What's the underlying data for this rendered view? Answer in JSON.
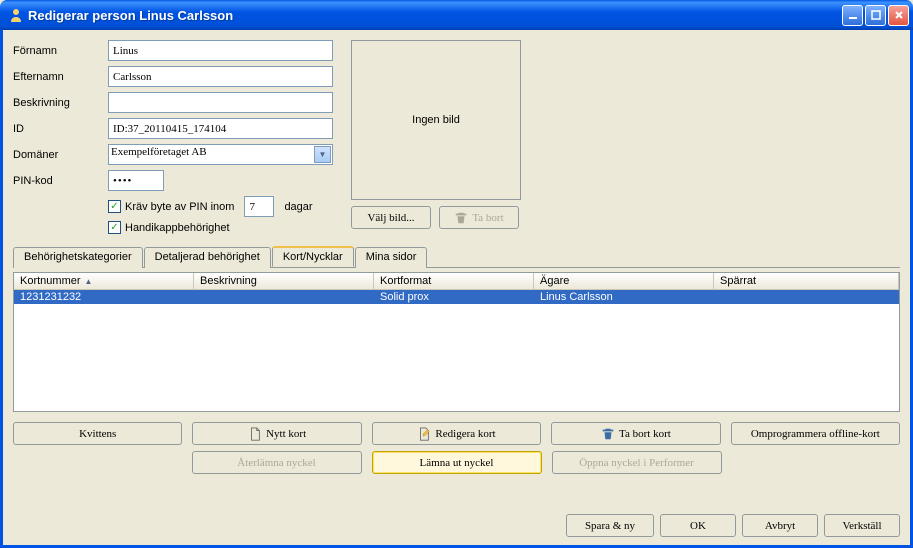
{
  "title": "Redigerar person Linus Carlsson",
  "form": {
    "fornamn_label": "Förnamn",
    "fornamn_value": "Linus",
    "efternamn_label": "Efternamn",
    "efternamn_value": "Carlsson",
    "beskrivning_label": "Beskrivning",
    "beskrivning_value": "",
    "id_label": "ID",
    "id_value": "ID:37_20110415_174104",
    "domaner_label": "Domäner",
    "domaner_value": "Exempelföretaget AB",
    "pinkod_label": "PIN-kod",
    "pinkod_value": "••••",
    "krav_byte_label": "Kräv byte av PIN inom",
    "krav_byte_days": "7",
    "dagar_label": "dagar",
    "handikapp_label": "Handikappbehörighet"
  },
  "image": {
    "placeholder": "Ingen bild",
    "valj_label": "Välj bild...",
    "tabort_label": "Ta bort"
  },
  "tabs": {
    "t1": "Behörighetskategorier",
    "t2": "Detaljerad behörighet",
    "t3": "Kort/Nycklar",
    "t4": "Mina sidor"
  },
  "table": {
    "headers": {
      "kortnummer": "Kortnummer",
      "beskrivning": "Beskrivning",
      "kortformat": "Kortformat",
      "agare": "Ägare",
      "sparrat": "Spärrat"
    },
    "row": {
      "kortnummer": "1231231232",
      "beskrivning": "",
      "kortformat": "Solid prox",
      "agare": "Linus Carlsson",
      "sparrat": ""
    }
  },
  "actions": {
    "kvittens": "Kvittens",
    "nytt_kort": "Nytt kort",
    "redigera_kort": "Redigera kort",
    "tabort_kort": "Ta bort kort",
    "omprogrammera": "Omprogrammera offline-kort",
    "aterlamna": "Återlämna nyckel",
    "lamna_ut": "Lämna ut nyckel",
    "oppna_performer": "Öppna nyckel i Performer"
  },
  "footer": {
    "spara_ny": "Spara & ny",
    "ok": "OK",
    "avbryt": "Avbryt",
    "verkstall": "Verkställ"
  }
}
